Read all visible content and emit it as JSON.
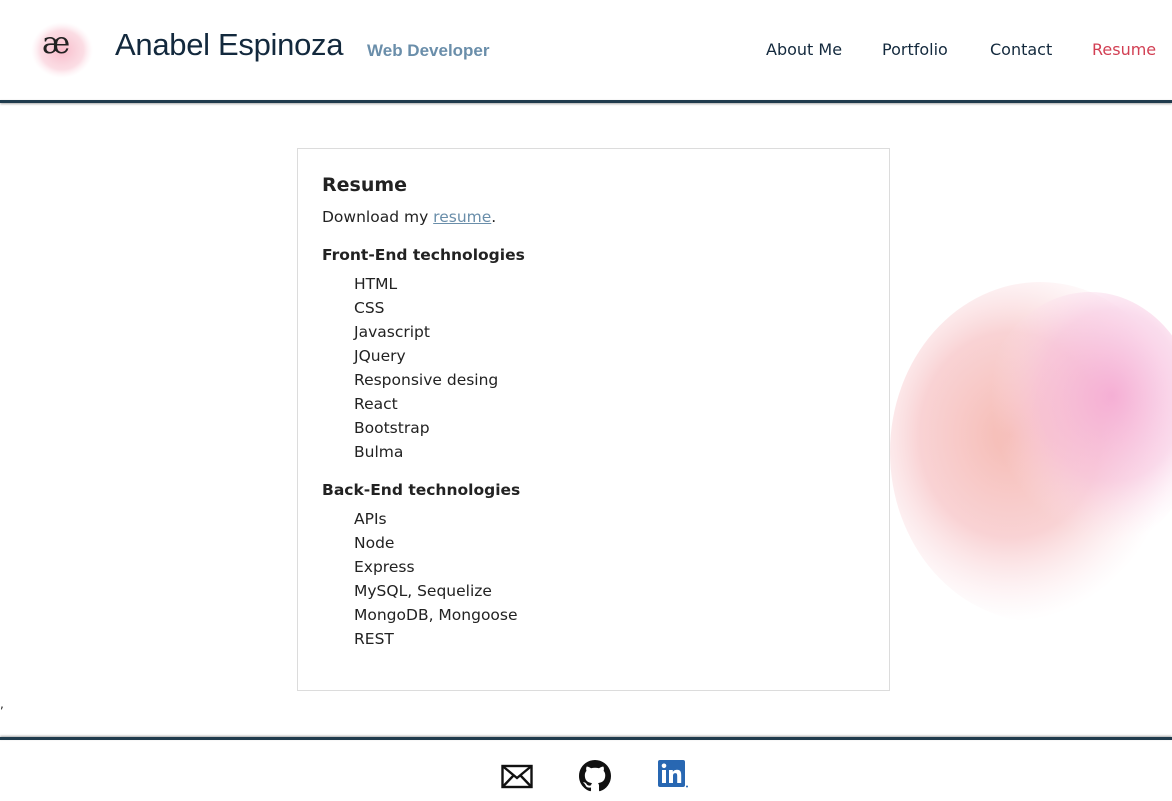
{
  "header": {
    "logo_text": "æ",
    "name": "Anabel Espinoza",
    "role": "Web Developer",
    "nav": [
      {
        "label": "About Me",
        "active": false
      },
      {
        "label": "Portfolio",
        "active": false
      },
      {
        "label": "Contact",
        "active": false
      },
      {
        "label": "Resume",
        "active": true
      }
    ]
  },
  "resume": {
    "title": "Resume",
    "download_prefix": "Download my ",
    "download_link": "resume",
    "download_suffix": ".",
    "front_end": {
      "title": "Front-End technologies",
      "items": [
        "HTML",
        "CSS",
        "Javascript",
        "JQuery",
        "Responsive desing",
        "React",
        "Bootstrap",
        "Bulma"
      ]
    },
    "back_end": {
      "title": "Back-End technologies",
      "items": [
        "APIs",
        "Node",
        "Express",
        "MySQL, Sequelize",
        "MongoDB, Mongoose",
        "REST"
      ]
    }
  },
  "stray_text": ",",
  "footer": {
    "icons": [
      "mail-icon",
      "github-icon",
      "linkedin-icon"
    ]
  },
  "colors": {
    "brand_dark": "#13293d",
    "accent_blue": "#6a8eaa",
    "active_nav": "#d23f53",
    "rule": "#1f3b4d",
    "linkedin": "#2867b2"
  }
}
